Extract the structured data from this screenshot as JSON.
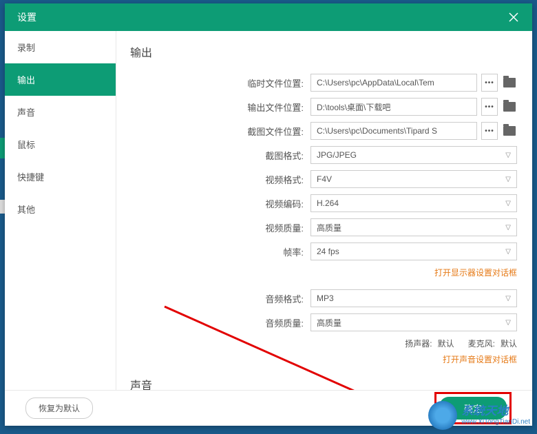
{
  "titlebar": {
    "title": "设置"
  },
  "sidebar": {
    "items": [
      {
        "label": "录制"
      },
      {
        "label": "输出"
      },
      {
        "label": "声音"
      },
      {
        "label": "鼠标"
      },
      {
        "label": "快捷键"
      },
      {
        "label": "其他"
      }
    ]
  },
  "content": {
    "section1_title": "输出",
    "temp_path": {
      "label": "临时文件位置:",
      "value": "C:\\Users\\pc\\AppData\\Local\\Tem"
    },
    "output_path": {
      "label": "输出文件位置:",
      "value": "D:\\tools\\桌面\\下载吧"
    },
    "screenshot_path": {
      "label": "截图文件位置:",
      "value": "C:\\Users\\pc\\Documents\\Tipard S"
    },
    "screenshot_format": {
      "label": "截图格式:",
      "value": "JPG/JPEG"
    },
    "video_format": {
      "label": "视频格式:",
      "value": "F4V"
    },
    "video_codec": {
      "label": "视频编码:",
      "value": "H.264"
    },
    "video_quality": {
      "label": "视频质量:",
      "value": "高质量"
    },
    "framerate": {
      "label": "帧率:",
      "value": "24 fps"
    },
    "display_link": "打开显示器设置对话框",
    "audio_format": {
      "label": "音频格式:",
      "value": "MP3"
    },
    "audio_quality": {
      "label": "音频质量:",
      "value": "高质量"
    },
    "speaker": {
      "label": "扬声器:",
      "value": "默认"
    },
    "mic": {
      "label": "麦克风:",
      "value": "默认"
    },
    "sound_link": "打开声音设置对话框",
    "section2_title": "声音"
  },
  "footer": {
    "reset_label": "恢复为默认",
    "ok_label": "确定"
  },
  "watermark": {
    "cn": "系统天地",
    "en": "www.XiTongTianDi.net"
  }
}
